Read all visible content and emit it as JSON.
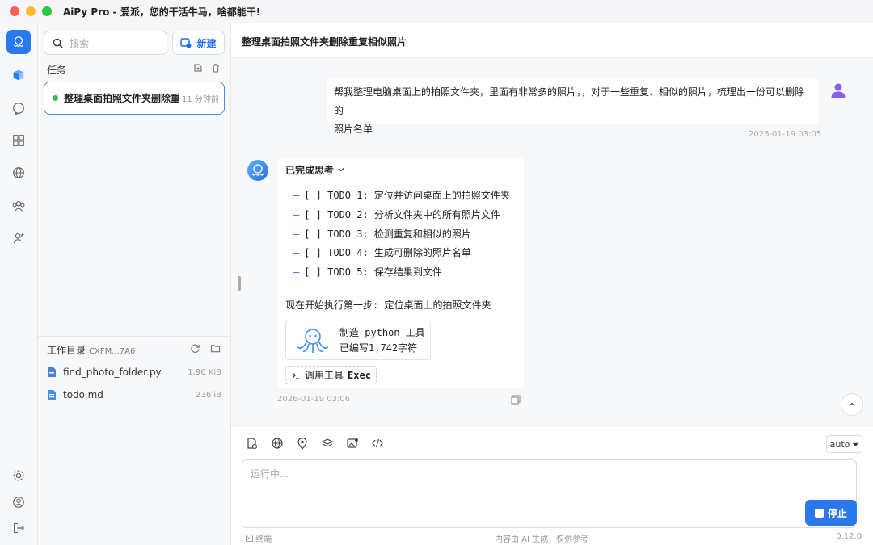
{
  "app": {
    "title": "AiPy Pro - 爱派，您的干活牛马，啥都能干!"
  },
  "rail": {
    "icons": [
      "logo-icon",
      "tasks-icon",
      "chat-icon",
      "apps-icon",
      "globe-icon",
      "team-icon",
      "user-star-icon",
      "settings-icon",
      "account-icon",
      "logout-icon"
    ]
  },
  "sidebar": {
    "search_placeholder": "搜索",
    "new_label": "新建",
    "tasks_title": "任务",
    "task": {
      "title": "整理桌面拍照文件夹删除重复相似照片",
      "time": "11 分钟前"
    },
    "workdir": {
      "title": "工作目录",
      "id": "CXFM...7A6",
      "files": [
        {
          "name": "find_photo_folder.py",
          "size": "1.96 KiB"
        },
        {
          "name": "todo.md",
          "size": "236 iB"
        }
      ]
    }
  },
  "main": {
    "title": "整理桌面拍照文件夹删除重复相似照片",
    "user_message_line1": "帮我整理电脑桌面上的拍照文件夹，里面有非常多的照片，，对于一些重复、相似的照片，梳理出一份可以删除的",
    "user_message_line2": "照片名单",
    "user_timestamp": "2026-01-19 03:05",
    "bot": {
      "thinking_label": "已完成思考",
      "todos": [
        "[ ] TODO 1: 定位并访问桌面上的拍照文件夹",
        "[ ] TODO 2: 分析文件夹中的所有照片文件",
        "[ ] TODO 3: 检测重复和相似的照片",
        "[ ] TODO 4: 生成可删除的照片名单",
        "[ ] TODO 5: 保存结果到文件"
      ],
      "start_line": "现在开始执行第一步: 定位桌面上的拍照文件夹",
      "tool_line1": "制造 python 工具",
      "tool_line2": "已编写1,742字符",
      "exec_prefix": "调用工具",
      "exec_name": "Exec",
      "timestamp": "2026-01-19 03:06"
    }
  },
  "composer": {
    "mode": "auto",
    "placeholder": "运行中...",
    "stop_label": "停止",
    "terminal_label": "终端",
    "disclaimer": "内容由 AI 生成，仅供参考",
    "version": "0.12.0"
  },
  "colors": {
    "accent": "#2a78ee",
    "active_border": "#3d8ef5",
    "status_dot": "#2fbf4f"
  }
}
